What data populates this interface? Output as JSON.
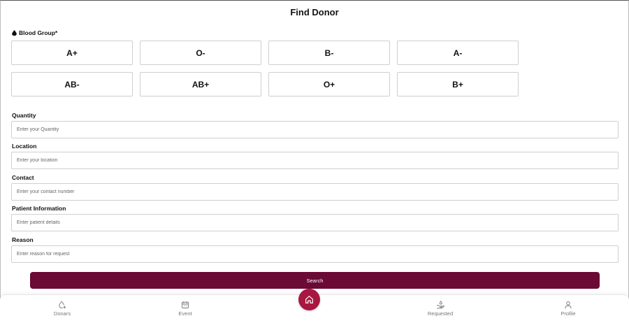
{
  "header": {
    "title": "Find Donor"
  },
  "blood_group": {
    "label": "Blood Group*",
    "options": [
      "A+",
      "O-",
      "B-",
      "A-",
      "AB-",
      "AB+",
      "O+",
      "B+"
    ]
  },
  "fields": {
    "quantity": {
      "label": "Quantity",
      "placeholder": "Enter your Quantity"
    },
    "location": {
      "label": "Location",
      "placeholder": "Enter your location"
    },
    "contact": {
      "label": "Contact",
      "placeholder": "Enter your contact number"
    },
    "patient": {
      "label": "Patient Information",
      "placeholder": "Enter patient details"
    },
    "reason": {
      "label": "Reason",
      "placeholder": "Enter reason for request"
    }
  },
  "actions": {
    "search_label": "Search"
  },
  "nav": {
    "items": [
      {
        "label": "Donars",
        "icon": "blood-drop-plus-icon"
      },
      {
        "label": "Event",
        "icon": "calendar-icon"
      },
      {
        "label": "Requested",
        "icon": "hand-drop-icon"
      },
      {
        "label": "Profile",
        "icon": "user-icon"
      }
    ],
    "home_icon": "home-icon"
  },
  "colors": {
    "primary": "#6b0a35",
    "home_accent": "#a8173f"
  }
}
